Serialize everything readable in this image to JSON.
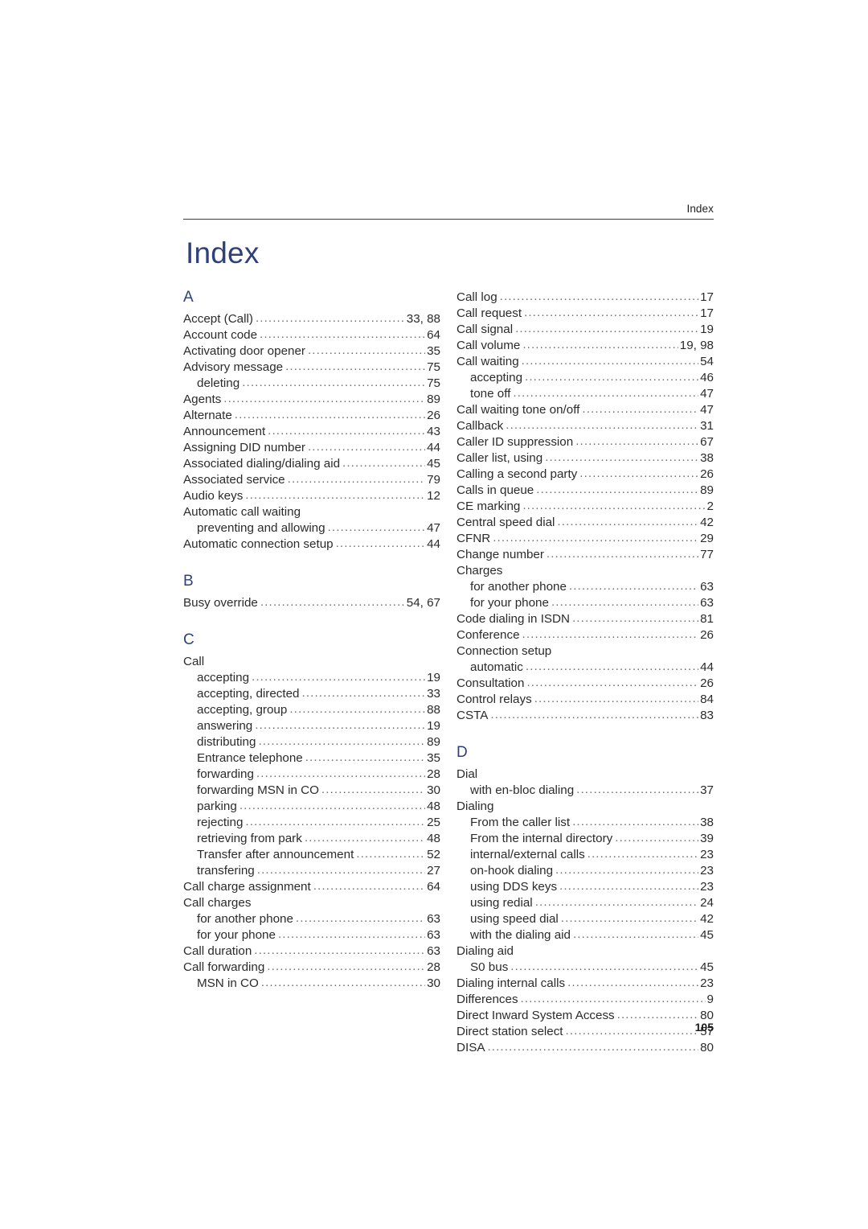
{
  "header": {
    "running_head": "Index"
  },
  "title": "Index",
  "folio": "105",
  "columns": [
    {
      "name": "left-column",
      "blocks": [
        {
          "type": "letter",
          "label": "A"
        },
        {
          "type": "entries",
          "items": [
            {
              "label": "Accept (Call)",
              "pages": "33, 88",
              "sub": false
            },
            {
              "label": "Account code",
              "pages": "64",
              "sub": false
            },
            {
              "label": "Activating door opener",
              "pages": "35",
              "sub": false
            },
            {
              "label": "Advisory message",
              "pages": "75",
              "sub": false
            },
            {
              "label": "deleting",
              "pages": "75",
              "sub": true
            },
            {
              "label": "Agents",
              "pages": "89",
              "sub": false
            },
            {
              "label": "Alternate",
              "pages": "26",
              "sub": false
            },
            {
              "label": "Announcement",
              "pages": "43",
              "sub": false
            },
            {
              "label": "Assigning DID number",
              "pages": "44",
              "sub": false
            },
            {
              "label": "Associated dialing/dialing aid",
              "pages": "45",
              "sub": false
            },
            {
              "label": "Associated service",
              "pages": "79",
              "sub": false
            },
            {
              "label": "Audio keys",
              "pages": "12",
              "sub": false
            },
            {
              "label": "Automatic call waiting",
              "pages": "",
              "sub": false
            },
            {
              "label": "preventing and allowing",
              "pages": "47",
              "sub": true
            },
            {
              "label": "Automatic connection setup",
              "pages": "44",
              "sub": false
            }
          ]
        },
        {
          "type": "letter",
          "label": "B",
          "spaced": true
        },
        {
          "type": "entries",
          "items": [
            {
              "label": "Busy override",
              "pages": "54, 67",
              "sub": false
            }
          ]
        },
        {
          "type": "letter",
          "label": "C",
          "spaced": true
        },
        {
          "type": "entries",
          "items": [
            {
              "label": "Call",
              "pages": "",
              "sub": false
            },
            {
              "label": "accepting",
              "pages": "19",
              "sub": true
            },
            {
              "label": "accepting, directed",
              "pages": "33",
              "sub": true
            },
            {
              "label": "accepting, group",
              "pages": "88",
              "sub": true
            },
            {
              "label": "answering",
              "pages": "19",
              "sub": true
            },
            {
              "label": "distributing",
              "pages": "89",
              "sub": true
            },
            {
              "label": "Entrance telephone",
              "pages": "35",
              "sub": true
            },
            {
              "label": "forwarding",
              "pages": "28",
              "sub": true
            },
            {
              "label": "forwarding MSN in CO",
              "pages": "30",
              "sub": true
            },
            {
              "label": "parking",
              "pages": "48",
              "sub": true
            },
            {
              "label": "rejecting",
              "pages": "25",
              "sub": true
            },
            {
              "label": "retrieving from park",
              "pages": "48",
              "sub": true
            },
            {
              "label": "Transfer after announcement",
              "pages": "52",
              "sub": true
            },
            {
              "label": "transfering",
              "pages": "27",
              "sub": true
            },
            {
              "label": "Call charge assignment",
              "pages": "64",
              "sub": false
            },
            {
              "label": "Call charges",
              "pages": "",
              "sub": false
            },
            {
              "label": "for another phone",
              "pages": "63",
              "sub": true
            },
            {
              "label": "for your phone",
              "pages": "63",
              "sub": true
            },
            {
              "label": "Call duration",
              "pages": "63",
              "sub": false
            },
            {
              "label": "Call forwarding",
              "pages": "28",
              "sub": false
            },
            {
              "label": "MSN in CO",
              "pages": "30",
              "sub": true
            }
          ]
        }
      ]
    },
    {
      "name": "right-column",
      "blocks": [
        {
          "type": "entries",
          "items": [
            {
              "label": "Call log",
              "pages": "17",
              "sub": false
            },
            {
              "label": "Call request",
              "pages": "17",
              "sub": false
            },
            {
              "label": "Call signal",
              "pages": "19",
              "sub": false
            },
            {
              "label": "Call volume",
              "pages": "19, 98",
              "sub": false
            },
            {
              "label": "Call waiting",
              "pages": "54",
              "sub": false
            },
            {
              "label": "accepting",
              "pages": "46",
              "sub": true
            },
            {
              "label": "tone off",
              "pages": "47",
              "sub": true
            },
            {
              "label": "Call waiting tone on/off",
              "pages": "47",
              "sub": false
            },
            {
              "label": "Callback",
              "pages": "31",
              "sub": false
            },
            {
              "label": "Caller ID suppression",
              "pages": "67",
              "sub": false
            },
            {
              "label": "Caller list, using",
              "pages": "38",
              "sub": false
            },
            {
              "label": "Calling a second party",
              "pages": "26",
              "sub": false
            },
            {
              "label": "Calls in queue",
              "pages": "89",
              "sub": false
            },
            {
              "label": "CE marking",
              "pages": "2",
              "sub": false
            },
            {
              "label": "Central speed dial",
              "pages": "42",
              "sub": false
            },
            {
              "label": "CFNR",
              "pages": "29",
              "sub": false
            },
            {
              "label": "Change number",
              "pages": "77",
              "sub": false
            },
            {
              "label": "Charges",
              "pages": "",
              "sub": false
            },
            {
              "label": "for another phone",
              "pages": "63",
              "sub": true
            },
            {
              "label": "for your phone",
              "pages": "63",
              "sub": true
            },
            {
              "label": "Code dialing in ISDN",
              "pages": "81",
              "sub": false
            },
            {
              "label": "Conference",
              "pages": "26",
              "sub": false
            },
            {
              "label": "Connection setup",
              "pages": "",
              "sub": false
            },
            {
              "label": "automatic",
              "pages": "44",
              "sub": true
            },
            {
              "label": "Consultation",
              "pages": "26",
              "sub": false
            },
            {
              "label": "Control relays",
              "pages": "84",
              "sub": false
            },
            {
              "label": "CSTA",
              "pages": "83",
              "sub": false
            }
          ]
        },
        {
          "type": "letter",
          "label": "D",
          "spaced": true
        },
        {
          "type": "entries",
          "items": [
            {
              "label": "Dial",
              "pages": "",
              "sub": false
            },
            {
              "label": "with en-bloc dialing",
              "pages": "37",
              "sub": true
            },
            {
              "label": "Dialing",
              "pages": "",
              "sub": false
            },
            {
              "label": "From the caller list",
              "pages": "38",
              "sub": true
            },
            {
              "label": "From the internal directory",
              "pages": "39",
              "sub": true
            },
            {
              "label": "internal/external calls",
              "pages": "23",
              "sub": true
            },
            {
              "label": "on-hook dialing",
              "pages": "23",
              "sub": true
            },
            {
              "label": "using DDS keys",
              "pages": "23",
              "sub": true
            },
            {
              "label": "using redial",
              "pages": "24",
              "sub": true
            },
            {
              "label": "using speed dial",
              "pages": "42",
              "sub": true
            },
            {
              "label": "with the dialing aid",
              "pages": "45",
              "sub": true
            },
            {
              "label": "Dialing aid",
              "pages": "",
              "sub": false
            },
            {
              "label": "S0 bus",
              "pages": "45",
              "sub": true
            },
            {
              "label": "Dialing internal calls",
              "pages": "23",
              "sub": false
            },
            {
              "label": "Differences",
              "pages": "9",
              "sub": false
            },
            {
              "label": "Direct Inward System Access",
              "pages": "80",
              "sub": false
            },
            {
              "label": "Direct station select",
              "pages": "57",
              "sub": false
            },
            {
              "label": "DISA",
              "pages": "80",
              "sub": false
            }
          ]
        }
      ]
    }
  ],
  "colors": {
    "heading_blue": "#2e4178",
    "body_text": "#2b2b2b",
    "leader_dots": "#6e6e6e",
    "rule": "#3a3a3a"
  }
}
